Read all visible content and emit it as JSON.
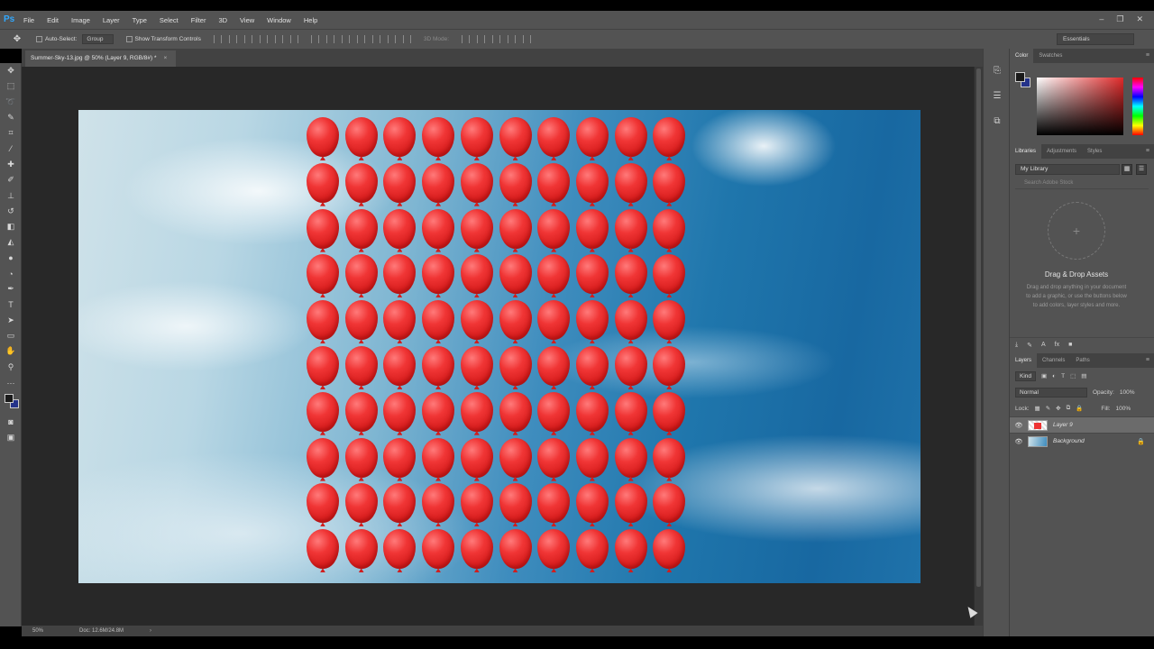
{
  "app": {
    "logo": "Ps"
  },
  "menu": [
    "File",
    "Edit",
    "Image",
    "Layer",
    "Type",
    "Select",
    "Filter",
    "3D",
    "View",
    "Window",
    "Help"
  ],
  "window_controls": {
    "minimize": "–",
    "restore": "❐",
    "close": "✕"
  },
  "options_bar": {
    "auto_select_label": "Auto-Select:",
    "auto_select_value": "Group",
    "show_transform_label": "Show Transform Controls",
    "mode3d_label": "3D Mode:",
    "workspace": "Essentials"
  },
  "document": {
    "tab_title": "Summer-Sky-13.jpg @ 50% (Layer 9, RGB/8#) *",
    "tab_close": "×",
    "zoom": "50%",
    "doc_size": "Doc: 12.6M/24.8M"
  },
  "canvas": {
    "balloon_rows": 10,
    "balloon_cols": 10,
    "balloon_color": "#e52a2a"
  },
  "tools": [
    "move-tool",
    "marquee-tool",
    "lasso-tool",
    "quick-select-tool",
    "crop-tool",
    "eyedropper-tool",
    "healing-brush-tool",
    "brush-tool",
    "clone-stamp-tool",
    "history-brush-tool",
    "eraser-tool",
    "paint-bucket-tool",
    "blur-tool",
    "dodge-tool",
    "pen-tool",
    "type-tool",
    "path-select-tool",
    "rectangle-tool",
    "hand-tool",
    "zoom-tool",
    "more-tools"
  ],
  "panels": {
    "color": {
      "tabs": [
        "Color",
        "Swatches"
      ],
      "fg": "#1a1a1a",
      "bg": "#25338a"
    },
    "libraries": {
      "tabs": [
        "Libraries",
        "Adjustments",
        "Styles"
      ],
      "library_name": "My Library",
      "search_placeholder": "Search Adobe Stock",
      "drop_title": "Drag & Drop Assets",
      "drop_desc": "Drag and drop anything in your document to add a graphic, or use the buttons below to add colors, layer styles and more."
    },
    "layers": {
      "tabs": [
        "Layers",
        "Channels",
        "Paths"
      ],
      "filter_kind": "Kind",
      "blend_mode": "Normal",
      "opacity_label": "Opacity:",
      "opacity_value": "100%",
      "lock_label": "Lock:",
      "fill_label": "Fill:",
      "fill_value": "100%",
      "items": [
        {
          "name": "Layer 9",
          "selected": true
        },
        {
          "name": "Background",
          "selected": false,
          "locked": true
        }
      ]
    }
  }
}
